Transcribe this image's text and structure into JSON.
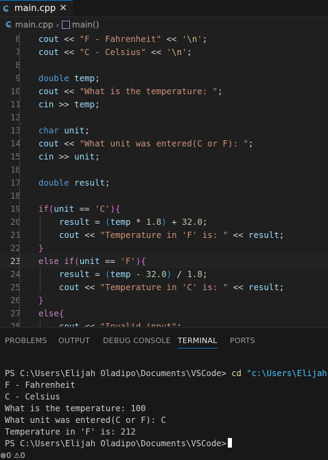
{
  "tab": {
    "icon": "cpp-file-icon",
    "label": "main.cpp",
    "close": "✕"
  },
  "breadcrumb": {
    "file": "main.cpp",
    "symbol": "main()"
  },
  "editor": {
    "current_line": 23,
    "lines": [
      {
        "n": "6",
        "ind": 1,
        "t": [
          [
            "id",
            "cout"
          ],
          [
            "op",
            " << "
          ],
          [
            "str",
            "\"F - Fahrenheit\""
          ],
          [
            "op",
            " << "
          ],
          [
            "str",
            "'"
          ],
          [
            "esc",
            "\\n"
          ],
          [
            "str",
            "'"
          ],
          [
            "op",
            ";"
          ]
        ]
      },
      {
        "n": "7",
        "ind": 1,
        "t": [
          [
            "id",
            "cout"
          ],
          [
            "op",
            " << "
          ],
          [
            "str",
            "\"C - Celsius\""
          ],
          [
            "op",
            " << "
          ],
          [
            "str",
            "'"
          ],
          [
            "esc",
            "\\n"
          ],
          [
            "str",
            "'"
          ],
          [
            "op",
            ";"
          ]
        ]
      },
      {
        "n": "8",
        "ind": 1,
        "t": []
      },
      {
        "n": "9",
        "ind": 1,
        "t": [
          [
            "kw",
            "double"
          ],
          [
            "op",
            " "
          ],
          [
            "id",
            "temp"
          ],
          [
            "op",
            ";"
          ]
        ]
      },
      {
        "n": "10",
        "ind": 1,
        "t": [
          [
            "id",
            "cout"
          ],
          [
            "op",
            " << "
          ],
          [
            "str",
            "\"What is the temperature: \""
          ],
          [
            "op",
            ";"
          ]
        ]
      },
      {
        "n": "11",
        "ind": 1,
        "t": [
          [
            "id",
            "cin"
          ],
          [
            "op",
            " >> "
          ],
          [
            "id",
            "temp"
          ],
          [
            "op",
            ";"
          ]
        ]
      },
      {
        "n": "12",
        "ind": 1,
        "t": []
      },
      {
        "n": "13",
        "ind": 1,
        "t": [
          [
            "kw",
            "char"
          ],
          [
            "op",
            " "
          ],
          [
            "id",
            "unit"
          ],
          [
            "op",
            ";"
          ]
        ]
      },
      {
        "n": "14",
        "ind": 1,
        "t": [
          [
            "id",
            "cout"
          ],
          [
            "op",
            " << "
          ],
          [
            "str",
            "\"What unit was entered(C or F): \""
          ],
          [
            "op",
            ";"
          ]
        ]
      },
      {
        "n": "15",
        "ind": 1,
        "t": [
          [
            "id",
            "cin"
          ],
          [
            "op",
            " >> "
          ],
          [
            "id",
            "unit"
          ],
          [
            "op",
            ";"
          ]
        ]
      },
      {
        "n": "16",
        "ind": 1,
        "t": []
      },
      {
        "n": "17",
        "ind": 1,
        "t": [
          [
            "kw",
            "double"
          ],
          [
            "op",
            " "
          ],
          [
            "id",
            "result"
          ],
          [
            "op",
            ";"
          ]
        ]
      },
      {
        "n": "18",
        "ind": 1,
        "t": []
      },
      {
        "n": "19",
        "ind": 1,
        "t": [
          [
            "ctl",
            "if"
          ],
          [
            "br1",
            "("
          ],
          [
            "id",
            "unit"
          ],
          [
            "op",
            " == "
          ],
          [
            "str",
            "'C'"
          ],
          [
            "br1",
            ")"
          ],
          [
            "br1",
            "{"
          ]
        ]
      },
      {
        "n": "20",
        "ind": 2,
        "t": [
          [
            "id",
            "result"
          ],
          [
            "op",
            " = "
          ],
          [
            "br2",
            "("
          ],
          [
            "id",
            "temp"
          ],
          [
            "op",
            " * "
          ],
          [
            "num",
            "1.8"
          ],
          [
            "br2",
            ")"
          ],
          [
            "op",
            " + "
          ],
          [
            "num",
            "32.0"
          ],
          [
            "op",
            ";"
          ]
        ]
      },
      {
        "n": "21",
        "ind": 2,
        "t": [
          [
            "id",
            "cout"
          ],
          [
            "op",
            " << "
          ],
          [
            "str",
            "\"Temperature in 'F' is: \""
          ],
          [
            "op",
            " << "
          ],
          [
            "id",
            "result"
          ],
          [
            "op",
            ";"
          ]
        ]
      },
      {
        "n": "22",
        "ind": 1,
        "t": [
          [
            "br1",
            "}"
          ]
        ]
      },
      {
        "n": "23",
        "ind": 1,
        "t": [
          [
            "ctl",
            "else"
          ],
          [
            "op",
            " "
          ],
          [
            "ctl",
            "if"
          ],
          [
            "br1",
            "("
          ],
          [
            "id",
            "unit"
          ],
          [
            "op",
            " == "
          ],
          [
            "str",
            "'F'"
          ],
          [
            "br1",
            ")"
          ],
          [
            "br1",
            "{"
          ]
        ]
      },
      {
        "n": "24",
        "ind": 2,
        "t": [
          [
            "id",
            "result"
          ],
          [
            "op",
            " = "
          ],
          [
            "br2",
            "("
          ],
          [
            "id",
            "temp"
          ],
          [
            "op",
            " - "
          ],
          [
            "num",
            "32.0"
          ],
          [
            "br2",
            ")"
          ],
          [
            "op",
            " / "
          ],
          [
            "num",
            "1.8"
          ],
          [
            "op",
            ";"
          ]
        ]
      },
      {
        "n": "25",
        "ind": 2,
        "t": [
          [
            "id",
            "cout"
          ],
          [
            "op",
            " << "
          ],
          [
            "str",
            "\"Temperature in 'C' is: \""
          ],
          [
            "op",
            " << "
          ],
          [
            "id",
            "result"
          ],
          [
            "op",
            ";"
          ]
        ]
      },
      {
        "n": "26",
        "ind": 1,
        "t": [
          [
            "br1",
            "}"
          ]
        ]
      },
      {
        "n": "27",
        "ind": 1,
        "t": [
          [
            "ctl",
            "else"
          ],
          [
            "br1",
            "{"
          ]
        ]
      },
      {
        "n": "28",
        "ind": 2,
        "t": [
          [
            "id",
            "cout"
          ],
          [
            "op",
            " << "
          ],
          [
            "str",
            "\"Invalid input\""
          ],
          [
            "op",
            ";"
          ]
        ]
      }
    ]
  },
  "panel": {
    "tabs": [
      "PROBLEMS",
      "OUTPUT",
      "DEBUG CONSOLE",
      "TERMINAL",
      "PORTS"
    ],
    "active_tab": "TERMINAL"
  },
  "terminal": {
    "prompt1": "PS C:\\Users\\Elijah Oladipo\\Documents\\VSCode>",
    "cmd": "cd",
    "cmd_arg": "\"c:\\Users\\Elijah Ola",
    "output": [
      "F - Fahrenheit",
      "C - Celsius",
      "What is the temperature: 100",
      "What unit was entered(C or F): C",
      "Temperature in 'F' is: 212"
    ],
    "prompt2": "PS C:\\Users\\Elijah Oladipo\\Documents\\VSCode>"
  },
  "status": {
    "errors": "0",
    "warnings": "0"
  }
}
